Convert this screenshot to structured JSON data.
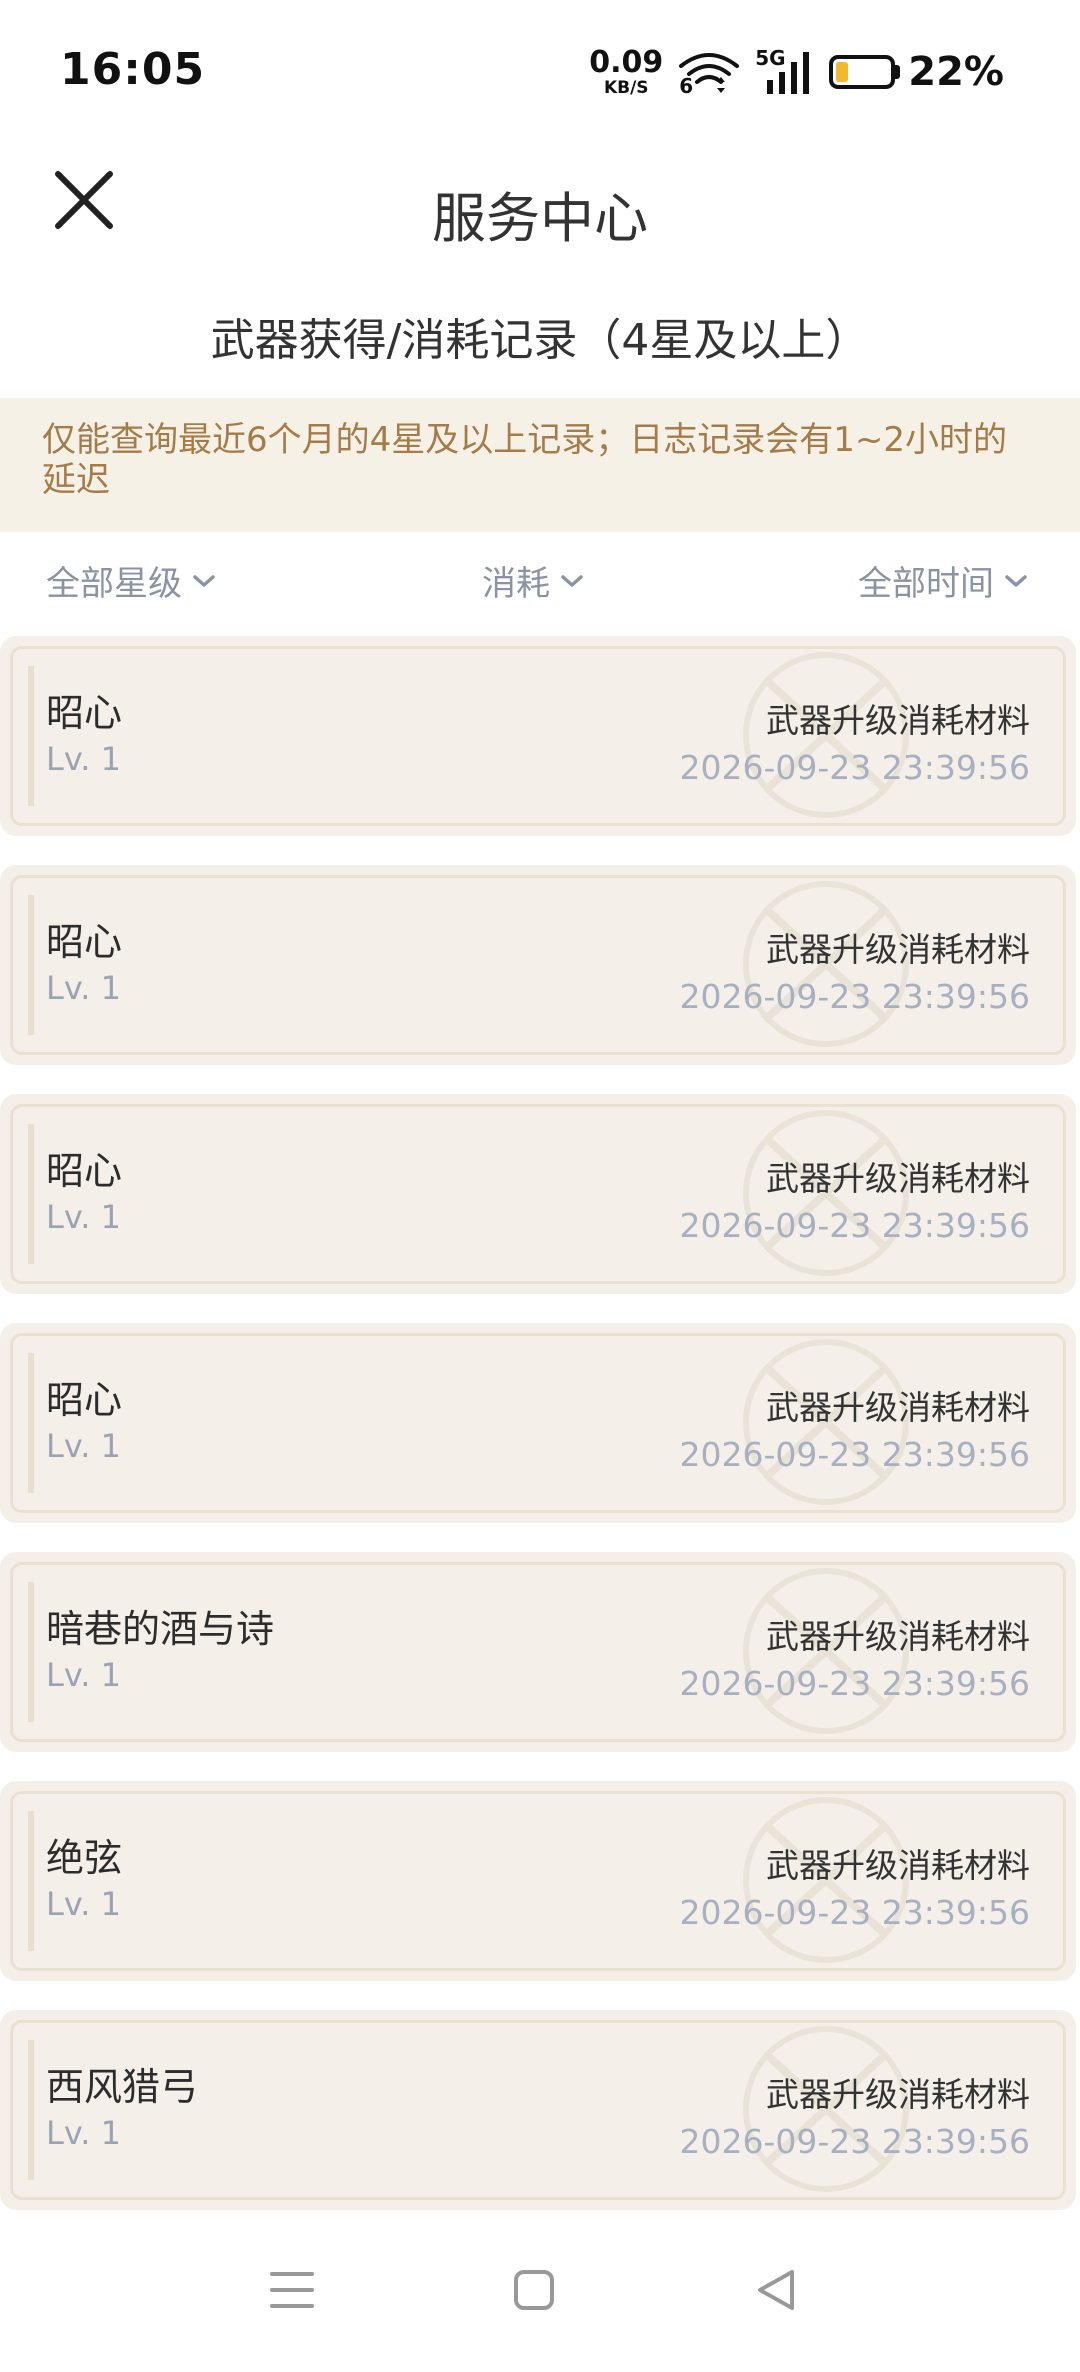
{
  "status_bar": {
    "time": "16:05",
    "net_speed_value": "0.09",
    "net_speed_unit": "KB/S",
    "wifi_badge": "6",
    "network_label": "5G",
    "battery_percent": "22%",
    "battery_level": 0.22,
    "icons": [
      "wifi-icon",
      "signal-icon",
      "battery-icon"
    ]
  },
  "header": {
    "title": "服务中心",
    "close_icon": "close-icon"
  },
  "subtitle": "武器获得/消耗记录（4星及以上）",
  "notice": "仅能查询最近6个月的4星及以上记录；日志记录会有1~2小时的延迟",
  "filters": {
    "star": "全部星级",
    "type": "消耗",
    "time": "全部时间",
    "chevron_icon": "chevron-down-icon"
  },
  "records": [
    {
      "name": "昭心",
      "level": "Lv. 1",
      "action": "武器升级消耗材料",
      "time": "2026-09-23 23:39:56"
    },
    {
      "name": "昭心",
      "level": "Lv. 1",
      "action": "武器升级消耗材料",
      "time": "2026-09-23 23:39:56"
    },
    {
      "name": "昭心",
      "level": "Lv. 1",
      "action": "武器升级消耗材料",
      "time": "2026-09-23 23:39:56"
    },
    {
      "name": "昭心",
      "level": "Lv. 1",
      "action": "武器升级消耗材料",
      "time": "2026-09-23 23:39:56"
    },
    {
      "name": "暗巷的酒与诗",
      "level": "Lv. 1",
      "action": "武器升级消耗材料",
      "time": "2026-09-23 23:39:56"
    },
    {
      "name": "绝弦",
      "level": "Lv. 1",
      "action": "武器升级消耗材料",
      "time": "2026-09-23 23:39:56"
    },
    {
      "name": "西风猎弓",
      "level": "Lv. 1",
      "action": "武器升级消耗材料",
      "time": "2026-09-23 23:39:56"
    }
  ],
  "nav": {
    "menu_icon": "menu-icon",
    "home_icon": "home-square-icon",
    "back_icon": "back-triangle-icon"
  },
  "colors": {
    "notice_bg": "#f6f1e6",
    "notice_text": "#a47c4a",
    "card_bg": "#f4f0e9",
    "battery_fill": "#f2b92c",
    "muted_text": "#a7b0c0"
  }
}
